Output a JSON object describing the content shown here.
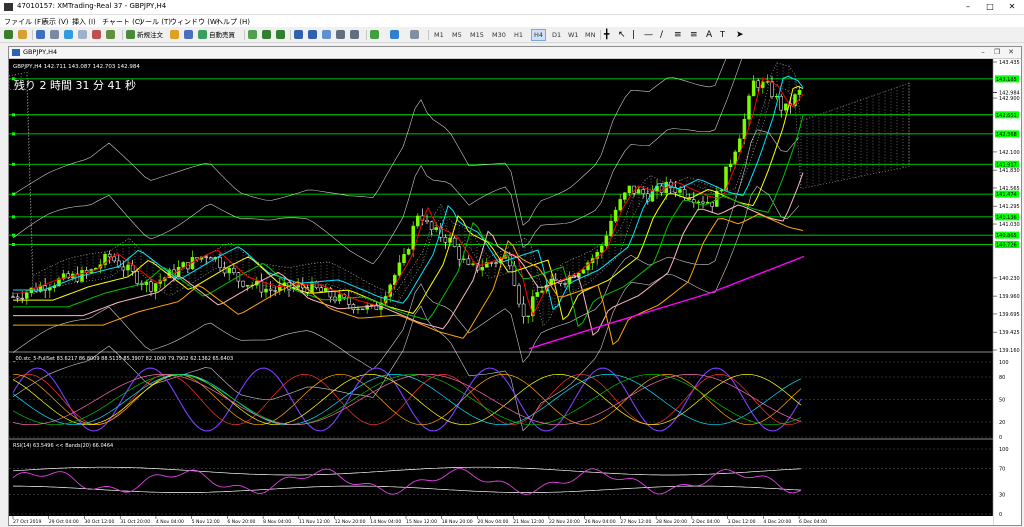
{
  "window": {
    "title": "47010157: XMTrading-Real 37 - GBPJPY,H4",
    "min_icon": "minimize-icon",
    "max_icon": "maximize-icon",
    "close_icon": "close-icon"
  },
  "menu": [
    {
      "label": "ファイル (F)"
    },
    {
      "label": "表示 (V)"
    },
    {
      "label": "挿入 (I)"
    },
    {
      "label": "チャート (C)"
    },
    {
      "label": "ツール (T)"
    },
    {
      "label": "ウィンドウ (W)"
    },
    {
      "label": "ヘルプ (H)"
    }
  ],
  "toolbar": {
    "new_order": "新規注文",
    "auto_trading": "自動売買",
    "timeframes": [
      "M1",
      "M5",
      "M15",
      "M30",
      "H1",
      "H4",
      "D1",
      "W1",
      "MN"
    ],
    "active_timeframe": "H4"
  },
  "chart": {
    "tab_title": "GBPJPY,H4",
    "ohlc_text": "GBPJPY,H4  142.711 143.087 142.703 142.984",
    "countdown": "残り 2 時間 31 分 41 秒",
    "osc_label": "_00.stc_5-FullSet 83.6217 86.8009 88.5135 85.3907 82.1000 79.7902 62.1362 65.6403",
    "rsi_label": "RSI(14) 63.5496   << Bands(20) 66.0464",
    "price_ticks": [
      "143.435",
      "142.984",
      "142.900",
      "142.100",
      "141.830",
      "141.565",
      "141.295",
      "141.030",
      "140.230",
      "139.960",
      "139.695",
      "139.425",
      "139.160"
    ],
    "green_levels": [
      {
        "price": "143.185"
      },
      {
        "price": "142.651"
      },
      {
        "price": "142.368"
      },
      {
        "price": "141.917"
      },
      {
        "price": "141.474"
      },
      {
        "price": "141.136"
      },
      {
        "price": "140.865"
      },
      {
        "price": "140.726"
      }
    ],
    "current_price": "142.984",
    "osc_ticks": [
      "100",
      "80",
      "50",
      "20",
      "0"
    ],
    "rsi_ticks": [
      "100",
      "70",
      "30",
      "0"
    ],
    "date_ticks": [
      "27 Oct 2019",
      "29 Oct 04:00",
      "30 Oct 12:00",
      "31 Oct 20:00",
      "4 Nov 04:00",
      "5 Nov 12:00",
      "6 Nov 20:00",
      "8 Nov 04:00",
      "11 Nov 12:00",
      "12 Nov 20:00",
      "14 Nov 04:00",
      "15 Nov 12:00",
      "18 Nov 20:00",
      "20 Nov 04:00",
      "21 Nov 12:00",
      "22 Nov 20:00",
      "26 Nov 04:00",
      "27 Nov 12:00",
      "28 Nov 20:00",
      "2 Dec 04:00",
      "3 Dec 12:00",
      "4 Dec 20:00",
      "6 Dec 04:00"
    ],
    "colors": {
      "background": "#000000",
      "up": "#7cfc00",
      "down": "#ffffff",
      "level": "#00ff00",
      "kijun": "#00e5ff",
      "tenkan": "#ff0000",
      "ma_yellow": "#ffff00",
      "ma_pink": "#ffb6c1",
      "ma_orange": "#ffa500",
      "ma_magenta": "#ff00ff",
      "osc_purple": "#7b3fff"
    }
  }
}
